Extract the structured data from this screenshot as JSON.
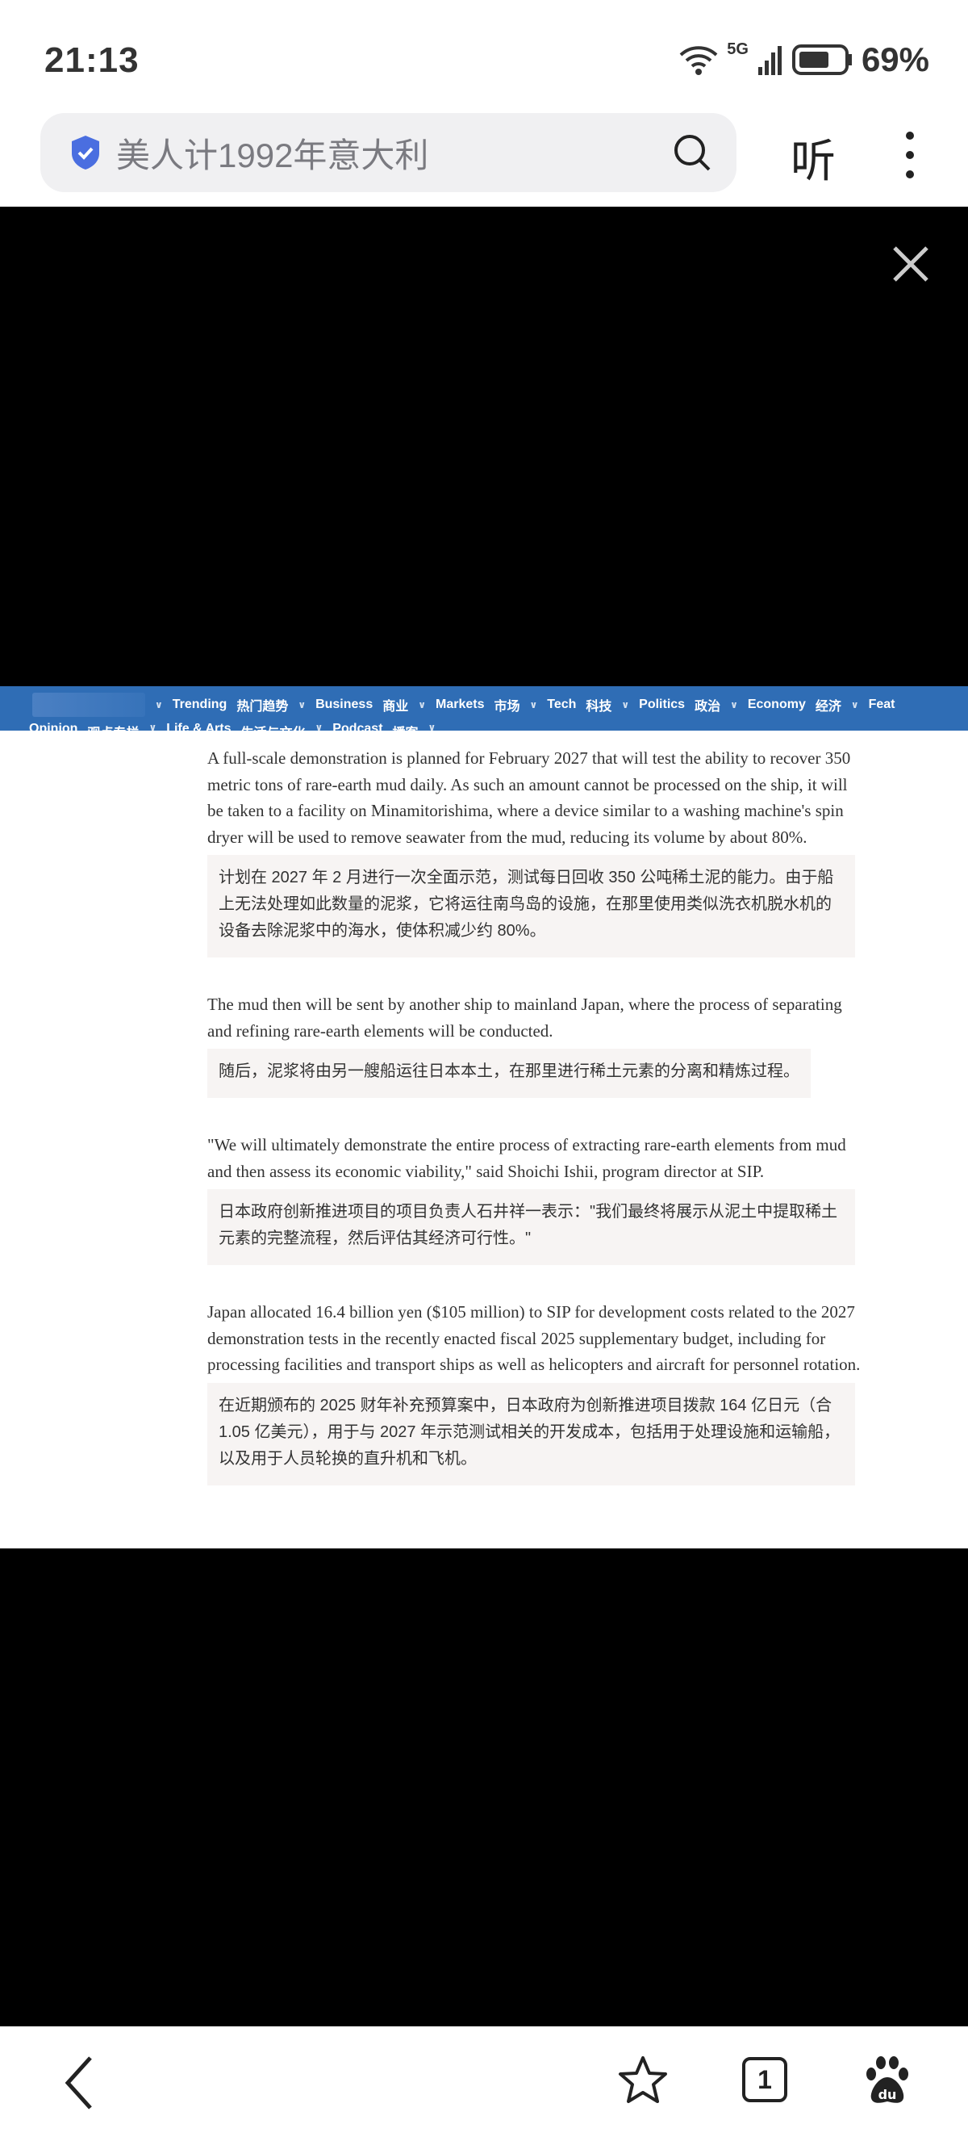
{
  "status_bar": {
    "time": "21:13",
    "network": "5G",
    "battery": "69%"
  },
  "address_bar": {
    "query": "美人计1992年意大利",
    "listen_label": "听"
  },
  "nav": {
    "row1": [
      "Trending",
      "热门趋势",
      "Business",
      "商业",
      "Markets",
      "市场",
      "Tech",
      "科技",
      "Politics",
      "政治",
      "Economy",
      "经济",
      "Feat"
    ],
    "row2": [
      "Opinion",
      "观点专栏",
      "Life & Arts",
      "生活与文化",
      "Podcast",
      "播客"
    ]
  },
  "article": [
    {
      "en": "A full-scale demonstration is planned for February 2027 that will test the ability to recover 350 metric tons of rare-earth mud daily. As such an amount cannot be processed on the ship, it will be taken to a facility on Minamitorishima, where a device similar to a washing machine's spin dryer will be used to remove seawater from the mud, reducing its volume by about 80%.",
      "zh": "计划在 2027 年 2 月进行一次全面示范，测试每日回收 350 公吨稀土泥的能力。由于船上无法处理如此数量的泥浆，它将运往南鸟岛的设施，在那里使用类似洗衣机脱水机的设备去除泥浆中的海水，使体积减少约 80%。"
    },
    {
      "en": "The mud then will be sent by another ship to mainland Japan, where the process of separating and refining rare-earth elements will be conducted.",
      "zh": "随后，泥浆将由另一艘船运往日本本土，在那里进行稀土元素的分离和精炼过程。"
    },
    {
      "en": "\"We will ultimately demonstrate the entire process of extracting rare-earth elements from mud and then assess its economic viability,\" said Shoichi Ishii, program director at SIP.",
      "zh": "日本政府创新推进项目的项目负责人石井祥一表示：\"我们最终将展示从泥土中提取稀土元素的完整流程，然后评估其经济可行性。\""
    },
    {
      "en": "Japan allocated 16.4 billion yen ($105 million) to SIP for development costs related to the 2027 demonstration tests in the recently enacted fiscal 2025 supplementary budget, including for processing facilities and transport ships as well as helicopters and aircraft for personnel rotation.",
      "zh": "在近期颁布的 2025 财年补充预算案中，日本政府为创新推进项目拨款 164 亿日元（合 1.05 亿美元），用于与 2027 年示范测试相关的开发成本，包括用于处理设施和运输船，以及用于人员轮换的直升机和飞机。"
    }
  ],
  "bottom_bar": {
    "tab_count": "1"
  },
  "colors": {
    "nav": "#2f6db5",
    "shield": "#4a6ee0",
    "quote_bg": "#f7f4f3"
  }
}
